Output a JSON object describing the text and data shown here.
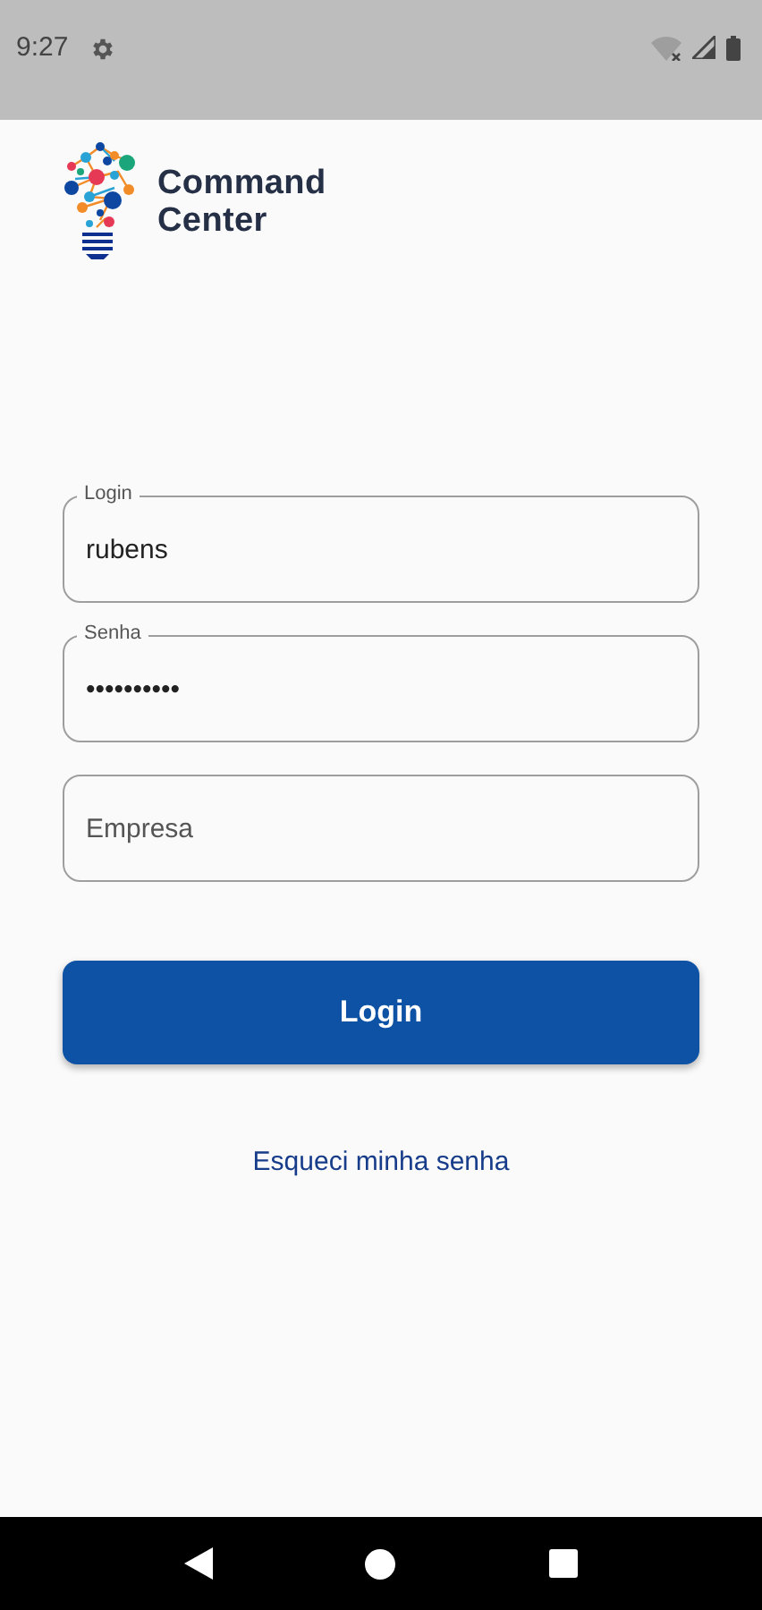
{
  "status_bar": {
    "time": "9:27"
  },
  "logo": {
    "text": "Command Center"
  },
  "fields": [
    {
      "label": "Login",
      "value": "rubens"
    },
    {
      "label": "Senha",
      "value": "••••••••••"
    },
    {
      "placeholder": "Empresa"
    }
  ],
  "login_button": "Login",
  "forgot_link": "Esqueci minha senha"
}
